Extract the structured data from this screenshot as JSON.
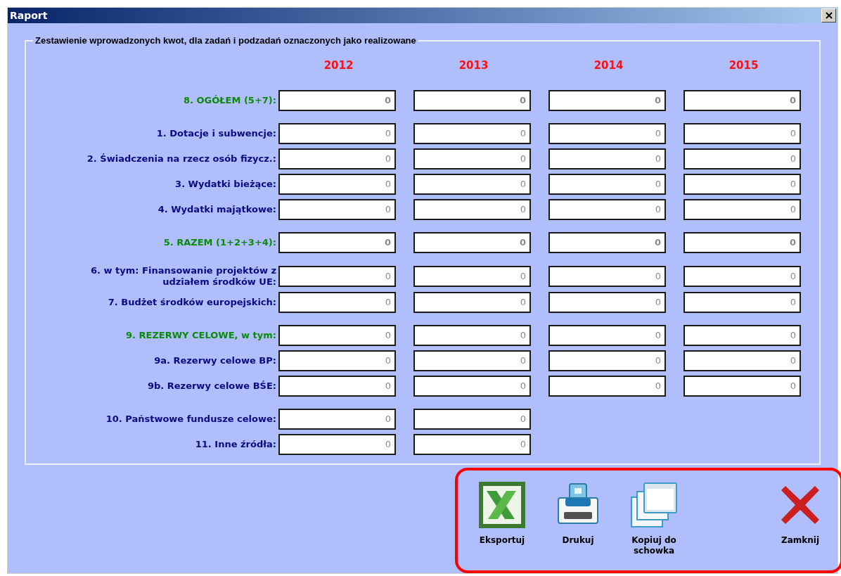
{
  "window": {
    "title": "Raport"
  },
  "group": {
    "title": "Zestawienie wprowadzonych kwot, dla zadań i podzadań oznaczonych jako realizowane",
    "years": [
      "2012",
      "2013",
      "2014",
      "2015"
    ],
    "sections": [
      {
        "rows": [
          {
            "kind": "sum",
            "label": [
              "8. OGÓŁEM (5+7):"
            ],
            "values": [
              "0",
              "0",
              "0",
              "0"
            ]
          }
        ]
      },
      {
        "rows": [
          {
            "kind": "item",
            "label": [
              "1. Dotacje i subwencje:"
            ],
            "values": [
              "0",
              "0",
              "0",
              "0"
            ]
          },
          {
            "kind": "item",
            "label": [
              "2. Świadczenia na rzecz osób fizycz.:"
            ],
            "values": [
              "0",
              "0",
              "0",
              "0"
            ]
          },
          {
            "kind": "item",
            "label": [
              "3. Wydatki bieżące:"
            ],
            "values": [
              "0",
              "0",
              "0",
              "0"
            ]
          },
          {
            "kind": "item",
            "label": [
              "4. Wydatki majątkowe:"
            ],
            "values": [
              "0",
              "0",
              "0",
              "0"
            ]
          }
        ]
      },
      {
        "rows": [
          {
            "kind": "sum",
            "label": [
              "5. RAZEM (1+2+3+4):"
            ],
            "values": [
              "0",
              "0",
              "0",
              "0"
            ]
          }
        ]
      },
      {
        "rows": [
          {
            "kind": "item",
            "label": [
              "6. w tym: Finansowanie projektów z",
              "udziałem środków UE:"
            ],
            "values": [
              "0",
              "0",
              "0",
              "0"
            ]
          },
          {
            "kind": "item",
            "label": [
              "7. Budżet środków europejskich:"
            ],
            "values": [
              "0",
              "0",
              "0",
              "0"
            ]
          }
        ]
      },
      {
        "rows": [
          {
            "kind": "heading",
            "label": [
              "9. REZERWY CELOWE, w tym:"
            ],
            "values": [
              "0",
              "0",
              "0",
              "0"
            ]
          },
          {
            "kind": "item",
            "label": [
              "9a. Rezerwy celowe BP:"
            ],
            "values": [
              "0",
              "0",
              "0",
              "0"
            ]
          },
          {
            "kind": "item",
            "label": [
              "9b. Rezerwy celowe BŚE:"
            ],
            "values": [
              "0",
              "0",
              "0",
              "0"
            ]
          }
        ]
      },
      {
        "rows": [
          {
            "kind": "item",
            "label": [
              "10. Państwowe fundusze celowe:"
            ],
            "values": [
              "0",
              "0"
            ]
          },
          {
            "kind": "item",
            "label": [
              "11. Inne źródła:"
            ],
            "values": [
              "0",
              "0"
            ]
          }
        ]
      }
    ]
  },
  "buttons": [
    {
      "kind": "export",
      "label": "Eksportuj"
    },
    {
      "kind": "print",
      "label": "Drukuj"
    },
    {
      "kind": "copy",
      "label": "Kopiuj do schowka"
    },
    {
      "kind": "close",
      "label": "Zamknij"
    }
  ]
}
